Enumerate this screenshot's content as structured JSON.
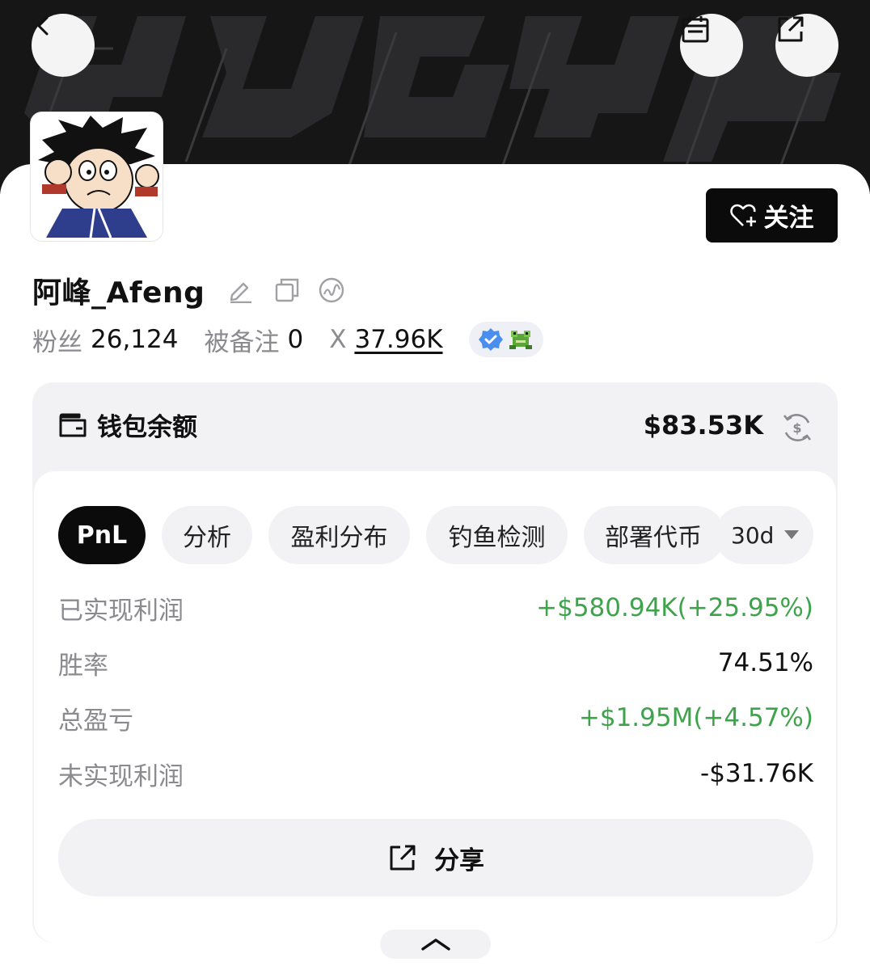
{
  "profile": {
    "name": "阿峰_Afeng",
    "followers_label": "粉丝",
    "followers_value": "26,124",
    "noted_label": "被备注",
    "noted_value": "0",
    "x_label": "X",
    "x_value": "37.96K",
    "follow_label": "关注"
  },
  "wallet": {
    "title": "钱包余额",
    "balance": "$83.53K"
  },
  "tabs": [
    {
      "label": "PnL",
      "active": true
    },
    {
      "label": "分析",
      "active": false
    },
    {
      "label": "盈利分布",
      "active": false
    },
    {
      "label": "钓鱼检测",
      "active": false
    },
    {
      "label": "部署代币",
      "active": false
    }
  ],
  "period": {
    "selected": "30d"
  },
  "metrics": [
    {
      "label": "已实现利润",
      "value": "+$580.94K(+25.95%)",
      "tone": "positive"
    },
    {
      "label": "胜率",
      "value": "74.51%",
      "tone": "neutral"
    },
    {
      "label": "总盈亏",
      "value": "+$1.95M(+4.57%)",
      "tone": "positive"
    },
    {
      "label": "未实现利润",
      "value": "-$31.76K",
      "tone": "neutral"
    }
  ],
  "share": {
    "label": "分享"
  },
  "colors": {
    "positive": "#3ea44c",
    "accent_dark": "#0b0b0b",
    "banner": "#161617",
    "card_bg": "#f2f2f4",
    "verified_blue": "#4a8ef0"
  },
  "icons": {
    "back": "chevron-left-icon",
    "calendar": "calendar-icon",
    "share_top": "external-link-icon",
    "edit": "pencil-icon",
    "copy": "copy-icon",
    "explorer": "explorer-icon",
    "verified": "verified-badge-icon",
    "frog": "frog-icon",
    "wallet": "wallet-icon",
    "swap": "currency-swap-icon",
    "follow": "heart-plus-icon",
    "share": "external-link-icon",
    "collapse": "chevron-up-icon"
  }
}
